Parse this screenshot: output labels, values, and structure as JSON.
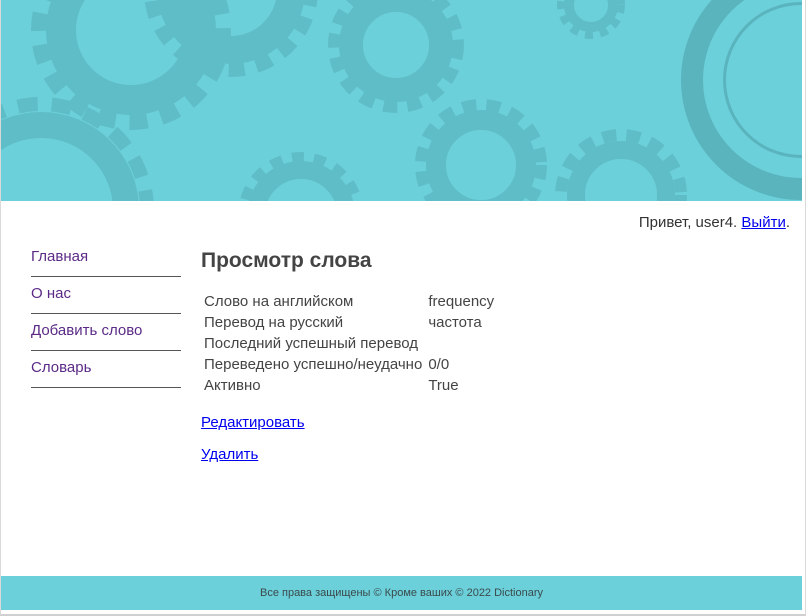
{
  "header": {
    "banner_icon": "gears-pattern",
    "banner_color": "#6cd0da",
    "gear_color": "#56afb8"
  },
  "user_bar": {
    "greeting": "Привет, user4.",
    "logout_label": "Выйти",
    "trailing": "."
  },
  "sidebar": {
    "items": [
      {
        "label": "Главная"
      },
      {
        "label": "О нас"
      },
      {
        "label": "Добавить слово"
      },
      {
        "label": "Словарь"
      }
    ]
  },
  "main": {
    "title": "Просмотр слова",
    "rows": [
      {
        "label": "Слово на английском",
        "value": "frequency"
      },
      {
        "label": "Перевод на русский",
        "value": "частота"
      },
      {
        "label": "Последний успешный перевод",
        "value": ""
      },
      {
        "label": "Переведено успешно/неудачно",
        "value": "0/0"
      },
      {
        "label": "Активно",
        "value": "True"
      }
    ],
    "edit_label": "Редактировать",
    "delete_label": "Удалить"
  },
  "footer": {
    "text": "Все права защищены © Кроме ваших © 2022 Dictionary"
  }
}
